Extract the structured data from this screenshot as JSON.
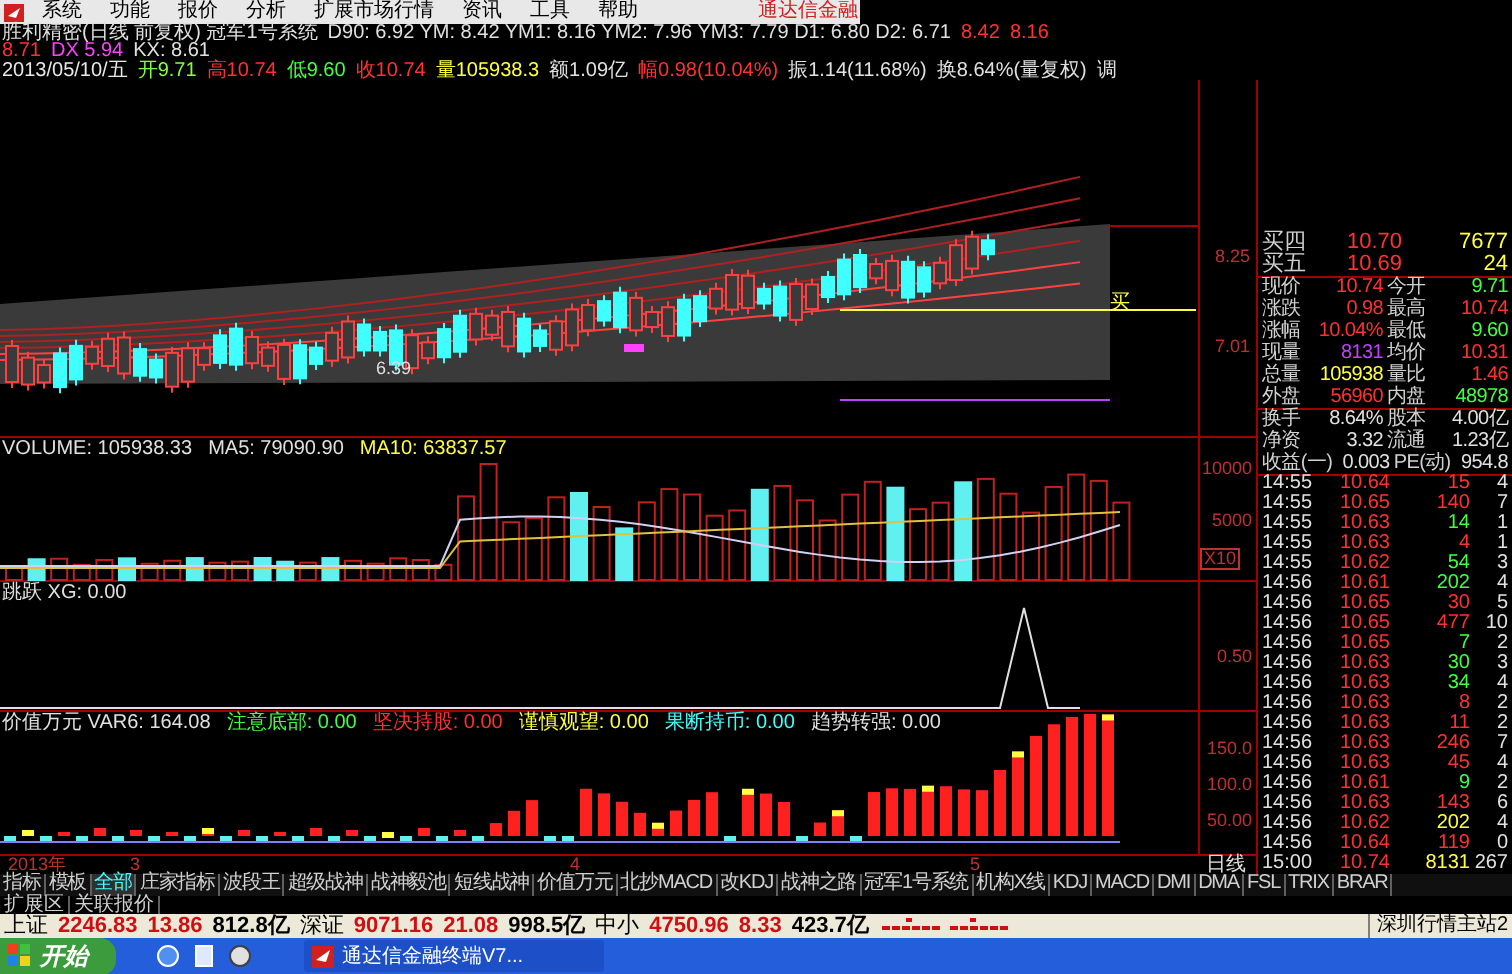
{
  "menu": {
    "items": [
      "系统",
      "功能",
      "报价",
      "分析",
      "扩展市场行情",
      "资讯",
      "工具",
      "帮助"
    ],
    "brand": "通达信金融"
  },
  "header": {
    "lines": [
      [
        {
          "text": "胜利精密(日线 前复权) 冠军1号系统",
          "color": "#e0e0e0"
        },
        {
          "text": "D90: 6.92 YM: 8.42 YM1: 8.16 YM2: 7.96 YM3: 7.79 D1: 6.80 D2: 6.71",
          "color": "#e0e0e0"
        },
        {
          "text": "8.42",
          "color": "#ff3030"
        },
        {
          "text": "8.16",
          "color": "#ff3030"
        }
      ],
      [
        {
          "text": "8.71",
          "color": "#ff3030"
        },
        {
          "text": "DX 5.94",
          "color": "#ff40ff"
        },
        {
          "text": "KX: 8.61",
          "color": "#e0e0e0"
        }
      ],
      [
        {
          "text": "2013/05/10/五",
          "color": "#e8e8e8"
        },
        {
          "text": "开9.71",
          "color": "#80ff40"
        },
        {
          "text": "高10.74",
          "color": "#ff3030"
        },
        {
          "text": "低9.60",
          "color": "#40ff40"
        },
        {
          "text": "收10.74",
          "color": "#ff3030"
        },
        {
          "text": "量105938.3",
          "color": "#ffff40"
        },
        {
          "text": "额1.09亿",
          "color": "#e0e0e0"
        },
        {
          "text": "幅0.98(10.04%)",
          "color": "#ff3030"
        },
        {
          "text": "振1.14(11.68%)",
          "color": "#e0e0e0"
        },
        {
          "text": "换8.64%(量复权)",
          "color": "#e0e0e0"
        },
        {
          "text": "调",
          "color": "#e0e0e0"
        }
      ]
    ]
  },
  "price_chart": {
    "low_label": "6.39",
    "signal_label": "买",
    "axis_labels": [
      "8.25",
      "7.01"
    ]
  },
  "volume_panel": {
    "title": [
      {
        "text": "VOLUME: 105938.33",
        "color": "#e0e0e0"
      },
      {
        "text": "MA5: 79090.90",
        "color": "#e0e0e0"
      },
      {
        "text": "MA10: 63837.57",
        "color": "#ffff40"
      }
    ],
    "axis_labels": [
      "10000",
      "5000"
    ],
    "unit": "X10"
  },
  "jump_panel": {
    "title": [
      {
        "text": "跳跃 XG: 0.00",
        "color": "#e0e0e0"
      }
    ],
    "axis_labels": [
      "0.50"
    ]
  },
  "value_panel": {
    "title": [
      {
        "text": "价值万元 VAR6: 164.08",
        "color": "#e0e0e0"
      },
      {
        "text": "注意底部: 0.00",
        "color": "#40ff40"
      },
      {
        "text": "坚决持股: 0.00",
        "color": "#ff3030"
      },
      {
        "text": "谨慎观望: 0.00",
        "color": "#ffff40"
      },
      {
        "text": "果断持币: 0.00",
        "color": "#40ffff"
      },
      {
        "text": "趋势转强: 0.00",
        "color": "#e0e0e0"
      }
    ],
    "axis_labels": [
      "150.0",
      "100.0",
      "50.00"
    ]
  },
  "date_axis": {
    "labels": [
      "2013年",
      "3",
      "4",
      "5"
    ],
    "period": "日线"
  },
  "quote": {
    "bids": [
      {
        "label": "买四",
        "price": "10.70",
        "volume": "7677"
      },
      {
        "label": "买五",
        "price": "10.69",
        "volume": "24"
      }
    ],
    "stats": [
      [
        {
          "label": "现价",
          "value": "10.74",
          "color": "#ff3030"
        },
        {
          "label": "今开",
          "value": "9.71",
          "color": "#40ff40"
        }
      ],
      [
        {
          "label": "涨跌",
          "value": "0.98",
          "color": "#ff3030"
        },
        {
          "label": "最高",
          "value": "10.74",
          "color": "#ff3030"
        }
      ],
      [
        {
          "label": "涨幅",
          "value": "10.04%",
          "color": "#ff3030"
        },
        {
          "label": "最低",
          "value": "9.60",
          "color": "#40ff40"
        }
      ],
      [
        {
          "label": "现量",
          "value": "8131",
          "color": "#c040ff"
        },
        {
          "label": "均价",
          "value": "10.31",
          "color": "#ff3030"
        }
      ],
      [
        {
          "label": "总量",
          "value": "105938",
          "color": "#ffff40"
        },
        {
          "label": "量比",
          "value": "1.46",
          "color": "#ff3030"
        }
      ],
      [
        {
          "label": "外盘",
          "value": "56960",
          "color": "#ff3030"
        },
        {
          "label": "内盘",
          "value": "48978",
          "color": "#40ff40"
        }
      ],
      [
        {
          "label": "换手",
          "value": "8.64%",
          "color": "#e0e0e0"
        },
        {
          "label": "股本",
          "value": "4.00亿",
          "color": "#e0e0e0"
        }
      ],
      [
        {
          "label": "净资",
          "value": "3.32",
          "color": "#e0e0e0"
        },
        {
          "label": "流通",
          "value": "1.23亿",
          "color": "#e0e0e0"
        }
      ],
      [
        {
          "label": "收益(一)",
          "value": "0.003",
          "color": "#e0e0e0"
        },
        {
          "label": "PE(动)",
          "value": "954.8",
          "color": "#e0e0e0"
        }
      ]
    ]
  },
  "ticks": [
    {
      "time": "14:55",
      "price": "10.64",
      "volume": "15",
      "count": "4",
      "color": "#ff3030"
    },
    {
      "time": "14:55",
      "price": "10.65",
      "volume": "140",
      "count": "7",
      "color": "#ff3030"
    },
    {
      "time": "14:55",
      "price": "10.63",
      "volume": "14",
      "count": "1",
      "color": "#40ff40"
    },
    {
      "time": "14:55",
      "price": "10.63",
      "volume": "4",
      "count": "1",
      "color": "#ff3030"
    },
    {
      "time": "14:55",
      "price": "10.62",
      "volume": "54",
      "count": "3",
      "color": "#40ff40"
    },
    {
      "time": "14:56",
      "price": "10.61",
      "volume": "202",
      "count": "4",
      "color": "#40ff40"
    },
    {
      "time": "14:56",
      "price": "10.65",
      "volume": "30",
      "count": "5",
      "color": "#ff3030"
    },
    {
      "time": "14:56",
      "price": "10.65",
      "volume": "477",
      "count": "10",
      "color": "#ff3030"
    },
    {
      "time": "14:56",
      "price": "10.65",
      "volume": "7",
      "count": "2",
      "color": "#40ff40"
    },
    {
      "time": "14:56",
      "price": "10.63",
      "volume": "30",
      "count": "3",
      "color": "#40ff40"
    },
    {
      "time": "14:56",
      "price": "10.63",
      "volume": "34",
      "count": "4",
      "color": "#40ff40"
    },
    {
      "time": "14:56",
      "price": "10.63",
      "volume": "8",
      "count": "2",
      "color": "#ff3030"
    },
    {
      "time": "14:56",
      "price": "10.63",
      "volume": "11",
      "count": "2",
      "color": "#ff3030"
    },
    {
      "time": "14:56",
      "price": "10.63",
      "volume": "246",
      "count": "7",
      "color": "#ff3030"
    },
    {
      "time": "14:56",
      "price": "10.63",
      "volume": "45",
      "count": "4",
      "color": "#ff3030"
    },
    {
      "time": "14:56",
      "price": "10.61",
      "volume": "9",
      "count": "2",
      "color": "#40ff40"
    },
    {
      "time": "14:56",
      "price": "10.63",
      "volume": "143",
      "count": "6",
      "color": "#ff3030"
    },
    {
      "time": "14:56",
      "price": "10.62",
      "volume": "202",
      "count": "4",
      "color": "#ffff40"
    },
    {
      "time": "14:56",
      "price": "10.64",
      "volume": "119",
      "count": "0",
      "color": "#ff3030"
    },
    {
      "time": "15:00",
      "price": "10.74",
      "volume": "8131",
      "count": "267",
      "color": "#ffff40"
    }
  ],
  "indicator_tabs": [
    {
      "label": "指标",
      "selected": false
    },
    {
      "label": "模板",
      "selected": false
    },
    {
      "label": "全部",
      "selected": true
    },
    {
      "label": "庄家指标",
      "selected": false
    },
    {
      "label": "波段王",
      "selected": false
    },
    {
      "label": "超级战神",
      "selected": false
    },
    {
      "label": "战神毅池",
      "selected": false
    },
    {
      "label": "短线战神",
      "selected": false
    },
    {
      "label": "价值万元",
      "selected": false
    },
    {
      "label": "北抄MACD",
      "selected": false
    },
    {
      "label": "改KDJ",
      "selected": false
    },
    {
      "label": "战神之路",
      "selected": false
    },
    {
      "label": "冠军1号系统",
      "selected": false
    },
    {
      "label": "机构X线",
      "selected": false
    },
    {
      "label": "KDJ",
      "selected": false
    },
    {
      "label": "MACD",
      "selected": false
    },
    {
      "label": "DMI",
      "selected": false
    },
    {
      "label": "DMA",
      "selected": false
    },
    {
      "label": "FSL",
      "selected": false
    },
    {
      "label": "TRIX",
      "selected": false
    },
    {
      "label": "BRAR",
      "selected": false
    }
  ],
  "extension_tabs": [
    "扩展区",
    "关联报价"
  ],
  "status_bar": {
    "indices": [
      {
        "name": "上证",
        "value": "2246.83",
        "change": "13.86",
        "amount": "812.8亿"
      },
      {
        "name": "深证",
        "value": "9071.16",
        "change": "21.08",
        "amount": "998.5亿"
      },
      {
        "name": "中小",
        "value": "4750.96",
        "change": "8.33",
        "amount": "423.7亿"
      }
    ],
    "server": "深圳行情主站2"
  },
  "taskbar": {
    "start": "开始",
    "task": "通达信金融终端V7..."
  }
}
